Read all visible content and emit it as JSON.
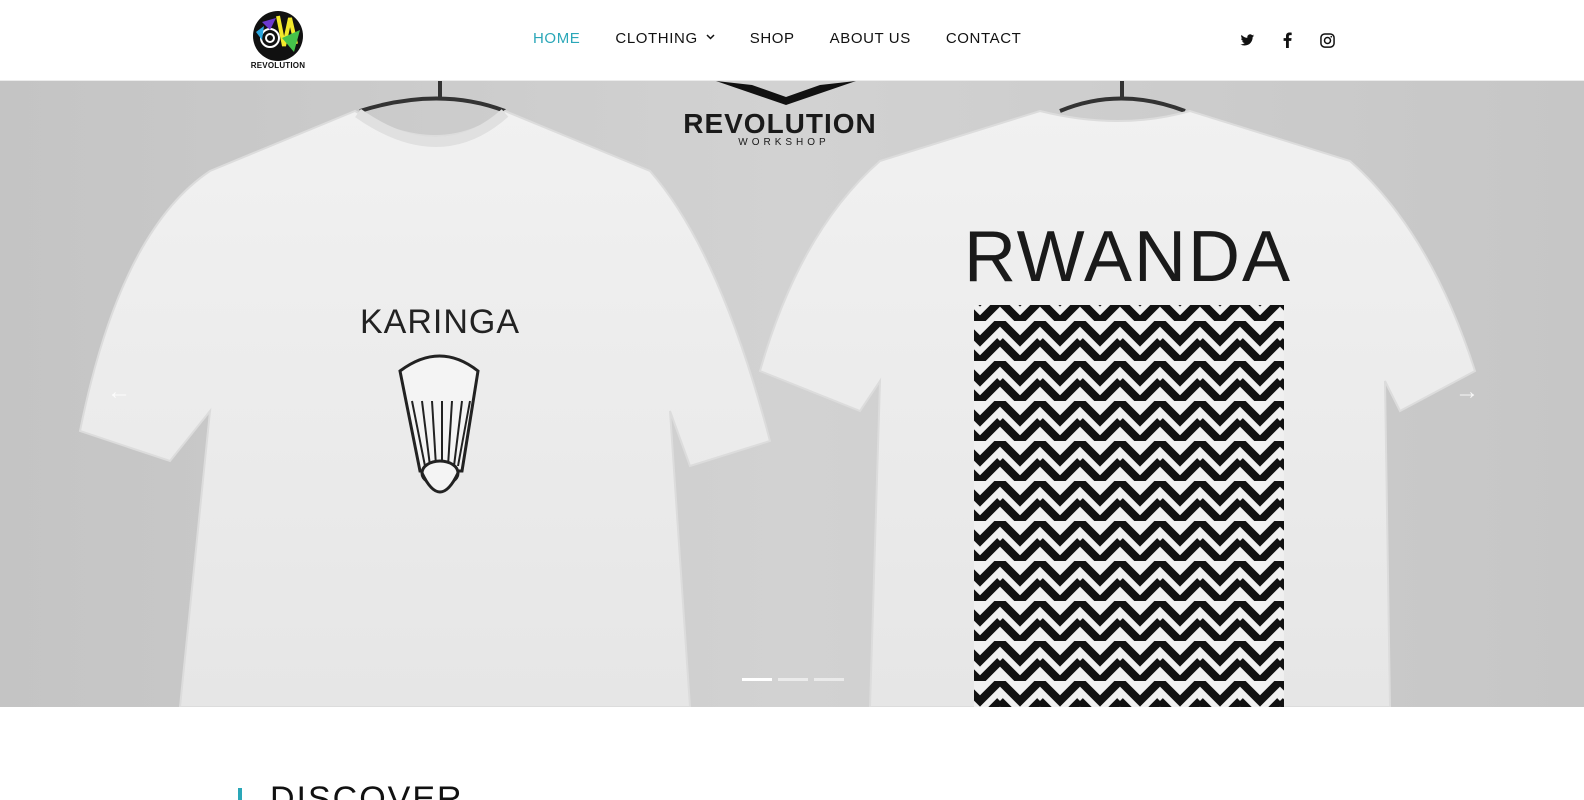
{
  "header": {
    "logo_text": "REVOLUTION",
    "nav": [
      {
        "label": "HOME",
        "active": true
      },
      {
        "label": "CLOTHING",
        "has_dropdown": true
      },
      {
        "label": "SHOP"
      },
      {
        "label": "ABOUT US"
      },
      {
        "label": "CONTACT"
      }
    ],
    "social_icons": [
      "twitter-icon",
      "facebook-icon",
      "instagram-icon"
    ]
  },
  "hero": {
    "brand_title": "REVOLUTION",
    "brand_subtitle": "WORKSHOP",
    "shirt_left_text": "KARINGA",
    "shirt_right_text": "RWANDA",
    "slides_count": 3,
    "active_slide": 1
  },
  "section": {
    "title": "DISCOVER"
  },
  "colors": {
    "accent": "#2aa7b8",
    "text": "#111111",
    "hero_bg": "#cdcdcd"
  }
}
